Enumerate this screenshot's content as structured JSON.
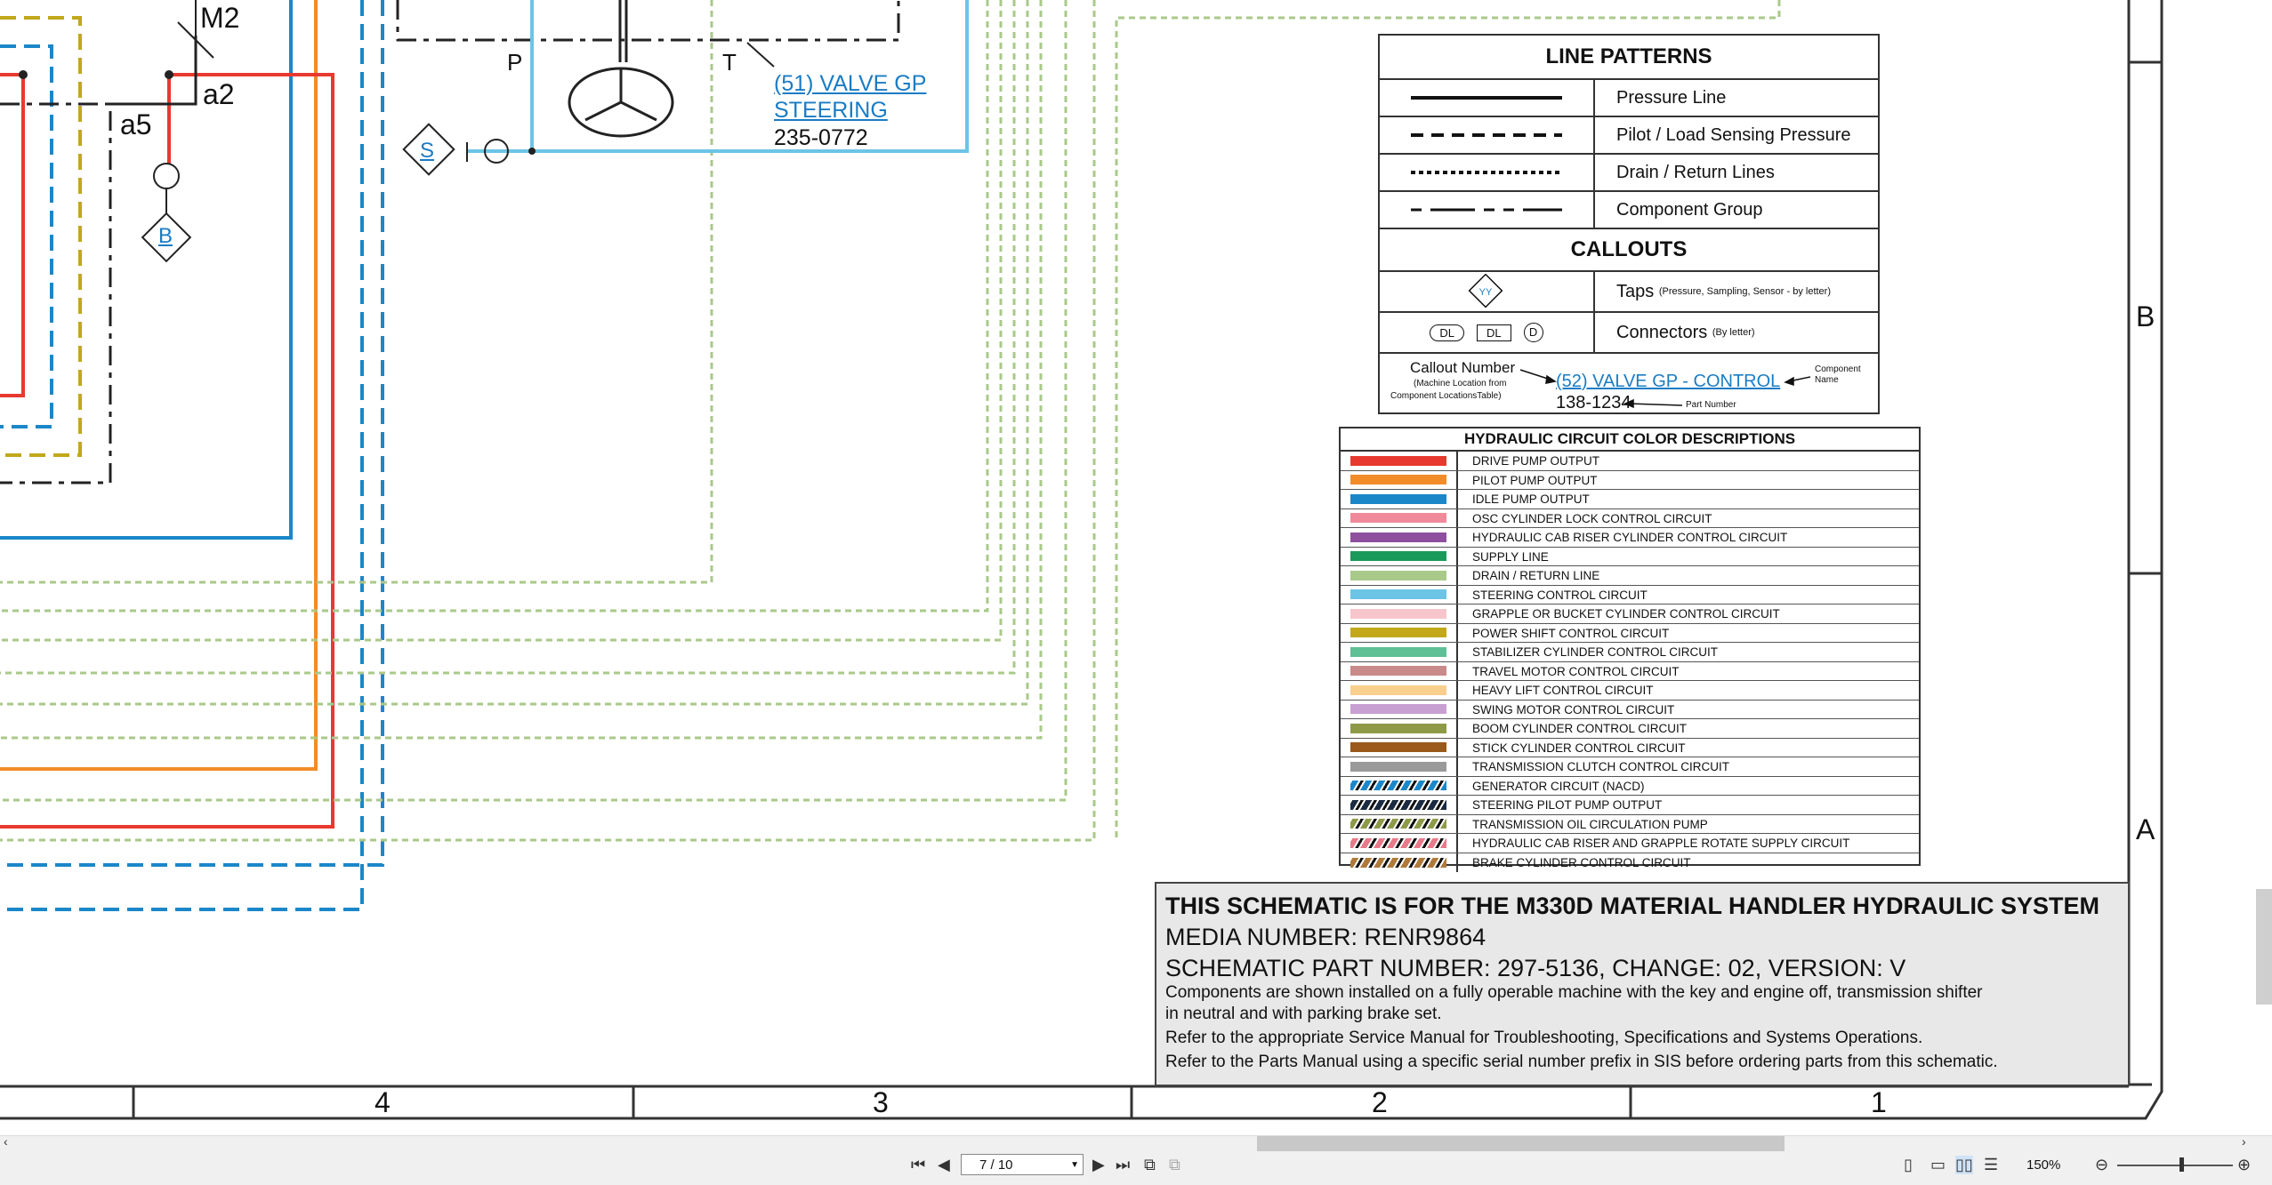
{
  "labels": {
    "m2": "M2",
    "a2": "a2",
    "a5": "a5",
    "p": "P",
    "t": "T",
    "tap_b": "B",
    "tap_s": "S"
  },
  "valve_callout": {
    "name_line1": "(51) VALVE GP",
    "name_line2": "STEERING",
    "part": "235-0772"
  },
  "line_patterns": {
    "title": "LINE PATTERNS",
    "rows": [
      {
        "label": "Pressure Line"
      },
      {
        "label": "Pilot / Load Sensing Pressure"
      },
      {
        "label": "Drain / Return Lines"
      },
      {
        "label": "Component Group"
      }
    ],
    "callouts_title": "CALLOUTS",
    "taps_label": "Taps",
    "taps_note": "(Pressure, Sampling, Sensor - by letter)",
    "taps_symbol": "YY",
    "connectors_label": "Connectors",
    "connectors_note": "(By letter)",
    "conn_dl1": "DL",
    "conn_dl2": "DL",
    "conn_d": "D",
    "callout_number": "Callout Number",
    "callout_number_note1": "(Machine Location from",
    "callout_number_note2": "Component LocationsTable)",
    "callout_example": "(52) VALVE GP - CONTROL",
    "component_name1": "Component",
    "component_name2": "Name",
    "example_part": "138-1234",
    "part_number_note": "Part Number"
  },
  "color_descriptions": {
    "title": "HYDRAULIC CIRCUIT COLOR DESCRIPTIONS",
    "rows": [
      {
        "label": "DRIVE PUMP OUTPUT",
        "color": "#e8392f"
      },
      {
        "label": "PILOT PUMP OUTPUT",
        "color": "#f28c28"
      },
      {
        "label": "IDLE PUMP OUTPUT",
        "color": "#1b87c9"
      },
      {
        "label": "OSC CYLINDER LOCK CONTROL CIRCUIT",
        "color": "#f08a9a"
      },
      {
        "label": "HYDRAULIC CAB RISER CYLINDER CONTROL CIRCUIT",
        "color": "#8e4f9e"
      },
      {
        "label": "SUPPLY LINE",
        "color": "#1a9a5a"
      },
      {
        "label": "DRAIN / RETURN LINE",
        "color": "#a9c98a"
      },
      {
        "label": "STEERING CONTROL CIRCUIT",
        "color": "#6cc4e6"
      },
      {
        "label": "GRAPPLE OR BUCKET CYLINDER CONTROL CIRCUIT",
        "color": "#f7c6cc"
      },
      {
        "label": "POWER SHIFT CONTROL CIRCUIT",
        "color": "#c2a81a"
      },
      {
        "label": "STABILIZER CYLINDER CONTROL CIRCUIT",
        "color": "#5fbf95"
      },
      {
        "label": "TRAVEL MOTOR CONTROL CIRCUIT",
        "color": "#c98a8a"
      },
      {
        "label": "HEAVY LIFT CONTROL CIRCUIT",
        "color": "#f9cf8e"
      },
      {
        "label": "SWING MOTOR CONTROL CIRCUIT",
        "color": "#c9a0d2"
      },
      {
        "label": "BOOM CYLINDER CONTROL CIRCUIT",
        "color": "#8f9a48"
      },
      {
        "label": "STICK CYLINDER CONTROL CIRCUIT",
        "color": "#9a5a1a"
      },
      {
        "label": "TRANSMISSION CLUTCH CONTROL CIRCUIT",
        "color": "#9a9a9a"
      },
      {
        "label": "GENERATOR CIRCUIT (NACD)",
        "color": "#1b87c9",
        "stripe": true
      },
      {
        "label": "STEERING PILOT PUMP OUTPUT",
        "color": "#1a2a40",
        "stripe": true
      },
      {
        "label": "TRANSMISSION OIL CIRCULATION PUMP",
        "color": "#8f9a48",
        "stripe": true
      },
      {
        "label": "HYDRAULIC CAB RISER AND GRAPPLE ROTATE SUPPLY CIRCUIT",
        "color": "#e87a8a",
        "stripe": true
      },
      {
        "label": "BRAKE CYLINDER CONTROL CIRCUIT",
        "color": "#b07a3a",
        "stripe": true
      }
    ]
  },
  "title_block": {
    "title": "THIS SCHEMATIC IS FOR THE M330D MATERIAL HANDLER HYDRAULIC SYSTEM",
    "media": "MEDIA NUMBER: RENR9864",
    "part": "SCHEMATIC PART NUMBER: 297-5136, CHANGE: 02, VERSION: V",
    "note1a": "Components are shown installed on a fully operable machine with the key and engine off, transmission shifter",
    "note1b": "in neutral and with parking brake set.",
    "note2": "Refer to the appropriate Service Manual for Troubleshooting, Specifications and Systems Operations.",
    "note3": "Refer to the Parts Manual using a specific serial number prefix in SIS before ordering parts from this schematic."
  },
  "grid": {
    "cols": [
      "4",
      "3",
      "2",
      "1"
    ],
    "rows": [
      "B",
      "A"
    ]
  },
  "viewer": {
    "page_indicator": "7 / 10",
    "zoom": "150%"
  }
}
